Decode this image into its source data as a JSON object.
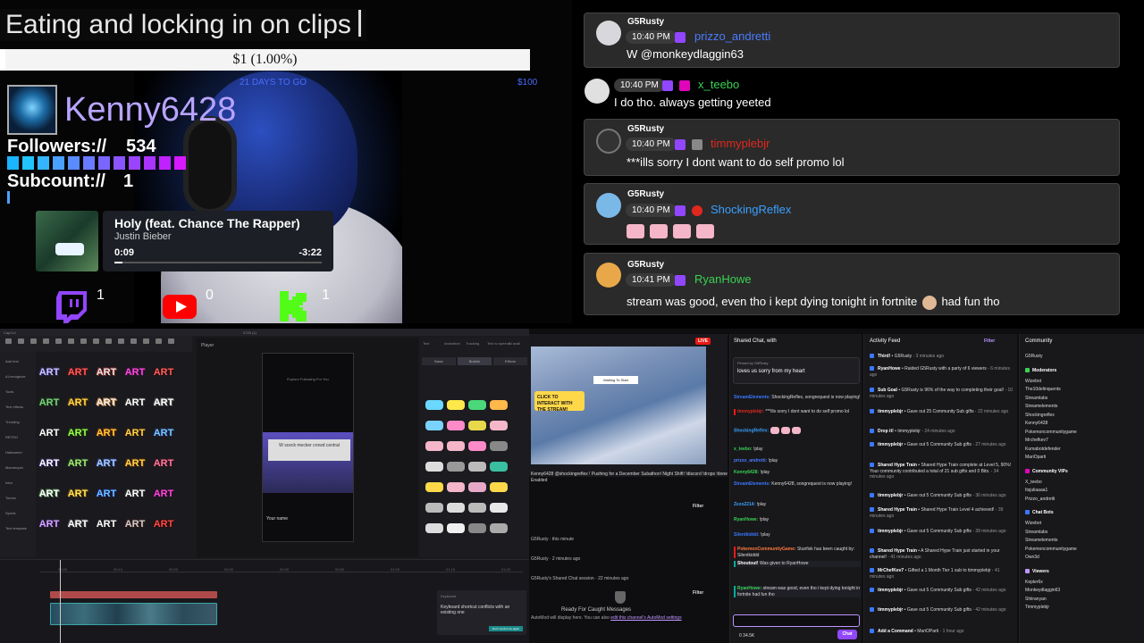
{
  "overlay": {
    "stream_title": "Eating and locking in on clips",
    "goal": {
      "amount_text": "$1 (1.00%)",
      "progress": 0.01,
      "days_left": "21 DAYS TO GO",
      "target": "$100"
    },
    "channel_name": "Kenny6428",
    "followers_label": "Followers://",
    "followers_value": "534",
    "subcount_label": "Subcount://",
    "subcount_value": "1",
    "follower_bar_colors": [
      "#1ab4ff",
      "#22c4ff",
      "#33b6ff",
      "#4aa0ff",
      "#5a8cff",
      "#6a7aff",
      "#7a66ff",
      "#8a55ff",
      "#9a44ff",
      "#aa33ff",
      "#c022ff",
      "#d818ff"
    ],
    "now_playing": {
      "title": "Holy (feat. Chance The Rapper)",
      "artist": "Justin Bieber",
      "current": "0:09",
      "remaining": "-3:22",
      "progress": 0.04
    },
    "platforms": {
      "twitch_count": "1",
      "youtube_count": "0",
      "kick_count": "1",
      "twitch_color": "#9146ff",
      "youtube_color": "#ff0000",
      "kick_color": "#53fc18"
    }
  },
  "chat": {
    "messages": [
      {
        "user_small": "G5Rusty",
        "time": "10:40 PM",
        "username": "prizzo_andretti",
        "name_color": "#4a7cff",
        "text": "W @monkeydlaggin63"
      },
      {
        "user_small": "",
        "time": "10:40 PM",
        "username": "x_teebo",
        "name_color": "#39d353",
        "text": "I do tho. always getting yeeted"
      },
      {
        "user_small": "G5Rusty",
        "time": "10:40 PM",
        "username": "timmyplebjr",
        "name_color": "#e0281e",
        "text": "***ills sorry I dont want to do self promo lol"
      },
      {
        "user_small": "G5Rusty",
        "time": "10:40 PM",
        "username": "ShockingReflex",
        "name_color": "#3aa0ff",
        "text": ""
      },
      {
        "user_small": "G5Rusty",
        "time": "10:41 PM",
        "username": "RyanHowe",
        "name_color": "#39d353",
        "text": "stream was good, even tho i kept dying tonight in fortnite",
        "text_after": "had fun tho"
      }
    ]
  },
  "capcut": {
    "app_name": "CapCut",
    "project_name": "0725 (1)",
    "player_label": "Player",
    "side_items": [
      "Add text",
      "AI-recognize",
      "Tools",
      "Text effects",
      "Trending",
      "RETRO",
      "Halloween",
      "Mannequin",
      "Intro",
      "Tomos",
      "Sports",
      "Text template"
    ],
    "art_label": "ART",
    "phone_tabs": "Explore   Following   For You",
    "caption": "W sceck mecker crowd central",
    "your_name": "Your name",
    "right_tabs": [
      "Text",
      "Animation",
      "Tracking",
      "Text to speech",
      "AI avail"
    ],
    "right_subtabs": [
      "Basic",
      "Bubble",
      "Effects"
    ],
    "toast_header": "Keyboard",
    "toast_message": "Keyboard shortcut conflicts with an existing one",
    "toast_button": "Don't remind me again",
    "ruler": [
      "00:00",
      "00:10",
      "00:20",
      "00:30",
      "00:40",
      "00:50",
      "01:00",
      "01:10",
      "01:20",
      "01:30"
    ]
  },
  "dashboard": {
    "live_badge": "LIVE",
    "video_cta": "CLICK TO INTERACT WITH THE STREAM!",
    "video_wait": "Waiting To Start",
    "stream_info": "Kenny6428 @shockingreflex ! Pushing for a December Subathon! Night Shift! !discord !drops !done",
    "stream_info_sub": "Enabled",
    "activity_rows": [
      "G5Rusty · this minute",
      "G5Rusty · 2 minutes ago",
      "G5Rusty's Shared Chat session · 22 minutes ago"
    ],
    "filter_label": "Filter",
    "ready_text": "Ready For Caught Messages",
    "automod_text": "AutoMod will display here. You can also",
    "automod_link": "edit this channel's AutoMod settings",
    "chat_header": "Shared Chat, with",
    "pinned_by": "Pinned by G5Rusty",
    "pinned_text": "loves us sorry from my heart",
    "chat_lines": [
      {
        "name": "StreamElements:",
        "color": "#3a78ff",
        "text": "ShockingReflex, songrequest is now playing!"
      },
      {
        "name": "timmyplebjr:",
        "color": "#e0281e",
        "text": "***ills sorry I dont want to do self promo lol"
      },
      {
        "name": "ShockingReflex:",
        "color": "#3aa0ff",
        "text": ""
      },
      {
        "name": "x_teebo:",
        "color": "#39d353",
        "text": "!play"
      },
      {
        "name": "prizzo_andretti:",
        "color": "#4a7cff",
        "text": "!play"
      },
      {
        "name": "Kenny6428:",
        "color": "#39d353",
        "text": "!play"
      },
      {
        "name": "StreamElements:",
        "color": "#3a78ff",
        "text": "Kenny6428, songrequest is now playing!"
      },
      {
        "name": "Zezo2214:",
        "color": "#3aa0ff",
        "text": "!play"
      },
      {
        "name": "RyanHowe:",
        "color": "#39d353",
        "text": "!play"
      },
      {
        "name": "Silentkiddd:",
        "color": "#3a78ff",
        "text": "!play"
      },
      {
        "name": "PokemonCommunityGame:",
        "color": "#ff7a3a",
        "text": "Stunfisk has been caught by: Silentkiddd"
      },
      {
        "name": "Shoutout!",
        "color": "#ffffff",
        "text": "Was given to RyanHowe"
      },
      {
        "name": "RyanHowe:",
        "color": "#39d353",
        "text": "stream was good, even tho i kept dying tonight in fortnite had fun tho"
      }
    ],
    "chat_button": "Chat",
    "viewer_stats": "0   34.5K",
    "feed_header": "Activity Feed",
    "feed": [
      {
        "title": "Third!",
        "detail": "G5Rusty",
        "ago": "3 minutes ago"
      },
      {
        "title": "RyanHowe",
        "detail": "Raided G5Rusty with a party of 6 viewers",
        "ago": "6 minutes ago"
      },
      {
        "title": "Sub Goal",
        "detail": "G5Rusty is 96% of the way to completing their goal!",
        "ago": "10 minutes ago"
      },
      {
        "title": "timmyplebjr",
        "detail": "Gave out 25 Community Sub gifts",
        "ago": "22 minutes ago"
      },
      {
        "title": "Drop it!",
        "detail": "timmyplebjr",
        "ago": "24 minutes ago"
      },
      {
        "title": "timmyplebjr",
        "detail": "Gave out 5 Community Sub gifts",
        "ago": "27 minutes ago"
      },
      {
        "title": "Shared Hype Train",
        "detail": "Shared Hype Train complete at Level 5, 90%! Your community contributed a total of 21 sub gifts and 0 Bits.",
        "ago": "34 minutes ago"
      },
      {
        "title": "timmyplebjr",
        "detail": "Gave out 5 Community Sub gifts",
        "ago": "36 minutes ago"
      },
      {
        "title": "Shared Hype Train",
        "detail": "Shared Hype Train Level 4 achieved!",
        "ago": "39 minutes ago"
      },
      {
        "title": "timmyplebjr",
        "detail": "Gave out 5 Community Sub gifts",
        "ago": "39 minutes ago"
      },
      {
        "title": "Shared Hype Train",
        "detail": "A Shared Hype Train just started in your channel!",
        "ago": "41 minutes ago"
      },
      {
        "title": "MrChefKev7",
        "detail": "Gifted a 1 Month Tier 1 sub to timmyplebjr",
        "ago": "41 minutes ago"
      },
      {
        "title": "timmyplebjr",
        "detail": "Gave out 5 Community Sub gifts",
        "ago": "42 minutes ago"
      },
      {
        "title": "timmyplebjr",
        "detail": "Gave out 5 Community Sub gifts",
        "ago": "42 minutes ago"
      },
      {
        "title": "Add a Command",
        "detail": "MariOParti",
        "ago": "1 hour ago"
      }
    ],
    "community_header": "Community",
    "community": [
      {
        "text": "G5Rusty",
        "section": false
      },
      {
        "text": "Moderators",
        "section": true,
        "color": "#39d353"
      },
      {
        "text": "Wizebot",
        "section": false
      },
      {
        "text": "The10delinquents",
        "section": false
      },
      {
        "text": "Streamlabs",
        "section": false
      },
      {
        "text": "Streamelements",
        "section": false
      },
      {
        "text": "Shockingreflex",
        "section": false
      },
      {
        "text": "Kenny6428",
        "section": false
      },
      {
        "text": "Pokemoncommunitygame",
        "section": false
      },
      {
        "text": "Mrchefkev7",
        "section": false
      },
      {
        "text": "Kumabotdefender",
        "section": false
      },
      {
        "text": "MariOparti",
        "section": false
      },
      {
        "text": "Community VIPs",
        "section": true,
        "color": "#e005b9"
      },
      {
        "text": "X_teebo",
        "section": false
      },
      {
        "text": "Itsjuliaaaa1",
        "section": false
      },
      {
        "text": "Prizzo_andretti",
        "section": false
      },
      {
        "text": "Chat Bots",
        "section": true,
        "color": "#3a78ff"
      },
      {
        "text": "Wizebot",
        "section": false
      },
      {
        "text": "Streamlabs",
        "section": false
      },
      {
        "text": "Streamelements",
        "section": false
      },
      {
        "text": "Pokemoncommunitygame",
        "section": false
      },
      {
        "text": "Own3d",
        "section": false
      },
      {
        "text": "Viewers",
        "section": true,
        "color": "#bf94ff"
      },
      {
        "text": "Kepler6x",
        "section": false
      },
      {
        "text": "Monkeydlaggin63",
        "section": false
      },
      {
        "text": "Shiiranyan",
        "section": false
      },
      {
        "text": "Timmyplebjr",
        "section": false
      }
    ]
  }
}
